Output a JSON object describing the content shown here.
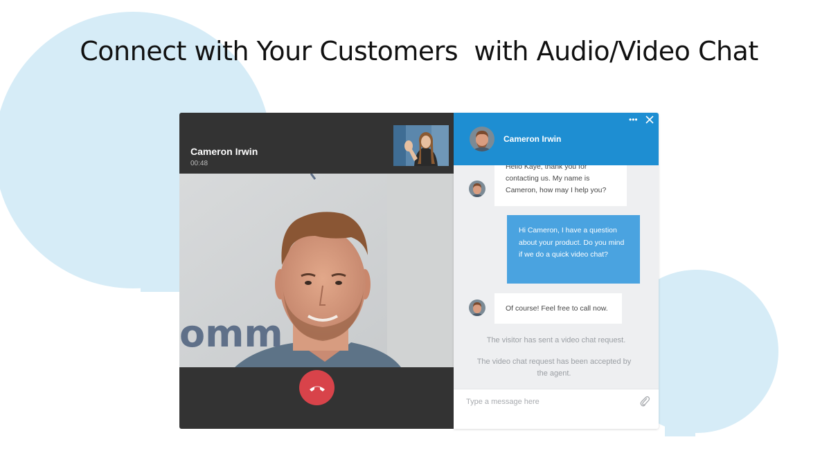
{
  "headline": "Connect with Your Customers  with Audio/Video Chat",
  "video_call": {
    "caller_name": "Cameron Irwin",
    "timer": "00:48",
    "wall_text": "omm"
  },
  "chat": {
    "agent_name": "Cameron Irwin",
    "messages": {
      "agent_first": "Hello Kaye, thank you for contacting us. My name is Cameron, how may I help you?",
      "visitor_question": "Hi Cameron, I have a question about your product. Do you mind if we do a quick video chat?",
      "agent_reply": "Of course! Feel free to call now."
    },
    "system": {
      "request_sent": "The visitor has sent a video chat request.",
      "request_accepted": "The video chat request has been accepted by the agent."
    },
    "composer_placeholder": "Type a message here"
  },
  "icons": {
    "hangup": "phone-hangup-icon",
    "more": "more-options-icon",
    "close": "close-icon",
    "attach": "paperclip-icon"
  },
  "colors": {
    "header_blue": "#1e8ed2",
    "visitor_bubble": "#4aa3e0",
    "hangup_red": "#d8434a",
    "video_panel_bg": "#333333",
    "decor_bubble": "#d6ecf7"
  }
}
